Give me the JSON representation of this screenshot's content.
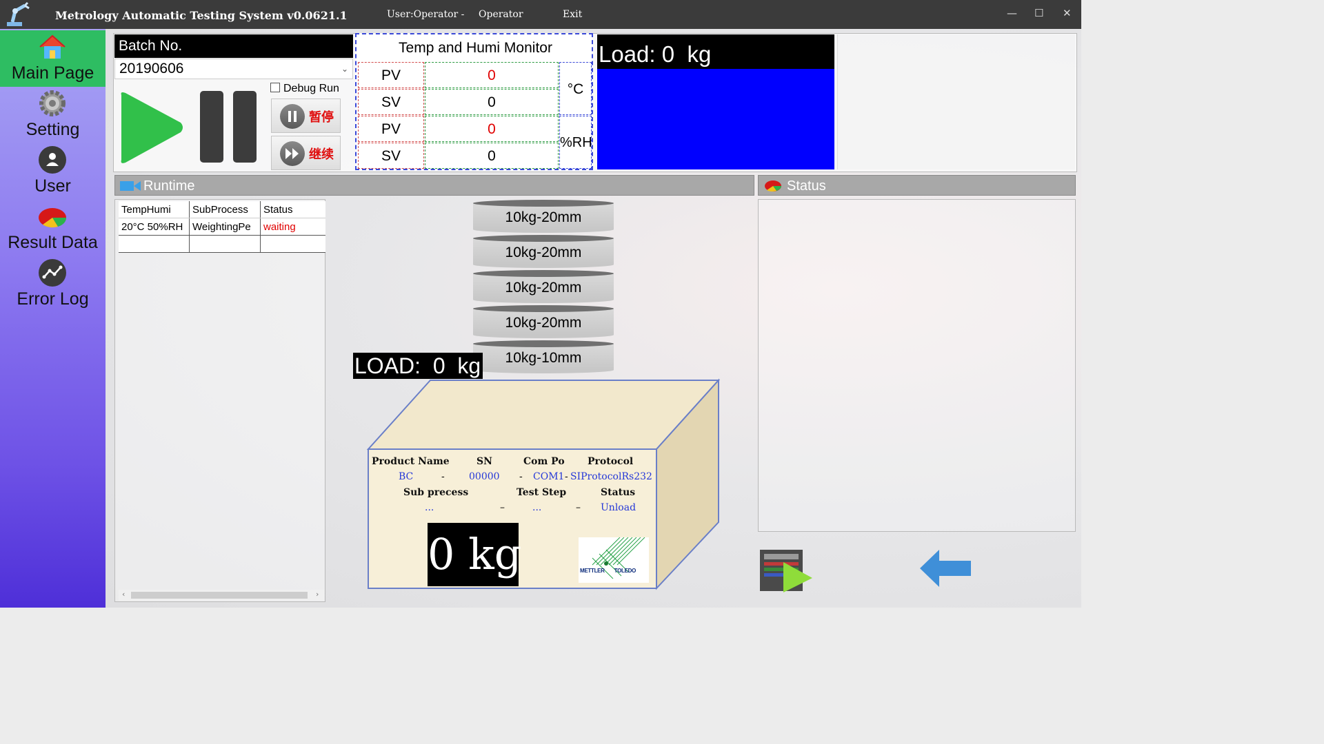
{
  "window": {
    "title": "Metrology Automatic Testing System v0.0621.1",
    "user_label": "User:Operator -",
    "user_name": "Operator",
    "exit_label": "Exit",
    "minimize": "—",
    "maximize": "☐",
    "close": "✕"
  },
  "sidebar": {
    "items": [
      {
        "label": "Main Page",
        "icon": "home-icon",
        "active": true
      },
      {
        "label": "Setting",
        "icon": "gear-icon"
      },
      {
        "label": "User",
        "icon": "user-icon"
      },
      {
        "label": "Result Data",
        "icon": "pie-chart-icon"
      },
      {
        "label": "Error Log",
        "icon": "line-chart-icon"
      }
    ]
  },
  "batch": {
    "header": "Batch No.",
    "value": "20190606",
    "debug_label": "Debug Run",
    "pause_label": "暂停",
    "continue_label": "继续"
  },
  "monitor": {
    "title": "Temp and Humi Monitor",
    "temp": {
      "pv_label": "PV",
      "pv_value": "0",
      "sv_label": "SV",
      "sv_value": "0",
      "unit": "°C"
    },
    "humi": {
      "pv_label": "PV",
      "pv_value": "0",
      "sv_label": "SV",
      "sv_value": "0",
      "unit": "%RH"
    }
  },
  "load_panel": {
    "title": "Load: 0  kg",
    "color": "#0000ff"
  },
  "runtime": {
    "title": "Runtime",
    "columns": [
      "TempHumi",
      "SubProcess",
      "Status"
    ],
    "rows": [
      [
        "20°C 50%RH",
        "WeightingPe",
        "waiting"
      ]
    ]
  },
  "status_panel": {
    "title": "Status"
  },
  "weights": [
    "10kg-20mm",
    "10kg-20mm",
    "10kg-20mm",
    "10kg-20mm",
    "10kg-10mm"
  ],
  "load_label": "LOAD:  0  kg",
  "scale": {
    "headers": {
      "product_name": "Product Name",
      "sn": "SN",
      "com_port": "Com Port",
      "protocol": "Protocol",
      "sub_process": "Sub precess",
      "test_step": "Test Step",
      "status": "Status"
    },
    "values": {
      "product_name": "BC",
      "sn": "00000",
      "com_port": "COM1",
      "protocol": "SIProtocolRs232",
      "sub_process": "...",
      "test_step": "...",
      "status": "Unload"
    },
    "sep1": "-",
    "sep2": "-",
    "sep3": "-",
    "sep4": "–",
    "sep5": "–",
    "display": "0 kg",
    "logo_left": "METTLER",
    "logo_right": "TOLEDO"
  },
  "colors": {
    "active_nav": "#2ebd62",
    "accent_red": "#e00000",
    "value_blue": "#2437d8"
  }
}
